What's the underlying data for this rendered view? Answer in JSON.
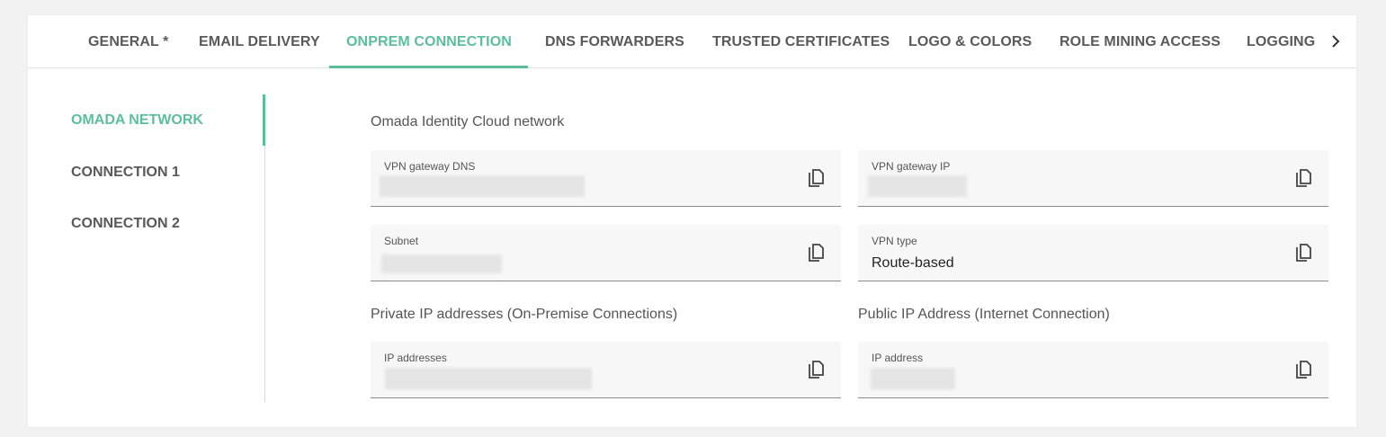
{
  "tabs": [
    {
      "label": "GENERAL *",
      "active": false
    },
    {
      "label": "EMAIL DELIVERY",
      "active": false
    },
    {
      "label": "ONPREM CONNECTION",
      "active": true
    },
    {
      "label": "DNS FORWARDERS",
      "active": false
    },
    {
      "label": "TRUSTED CERTIFICATES",
      "active": false
    },
    {
      "label": "LOGO & COLORS",
      "active": false
    },
    {
      "label": "ROLE MINING ACCESS",
      "active": false
    },
    {
      "label": "LOGGING",
      "active": false
    }
  ],
  "tab_scroll_icon": "chevron-right-icon",
  "sidenav": {
    "items": [
      {
        "label": "OMADA NETWORK",
        "active": true
      },
      {
        "label": "CONNECTION 1",
        "active": false
      },
      {
        "label": "CONNECTION 2",
        "active": false
      }
    ]
  },
  "main": {
    "network_title": "Omada Identity Cloud network",
    "private_title": "Private IP addresses (On-Premise Connections)",
    "public_title": "Public IP Address (Internet Connection)",
    "fields": {
      "vpn_gateway_dns": {
        "label": "VPN gateway DNS",
        "value": ""
      },
      "vpn_gateway_ip": {
        "label": "VPN gateway IP",
        "value": ""
      },
      "subnet": {
        "label": "Subnet",
        "value": ""
      },
      "vpn_type": {
        "label": "VPN type",
        "value": "Route-based"
      },
      "ip_addresses": {
        "label": "IP addresses",
        "value": ""
      },
      "ip_address": {
        "label": "IP address",
        "value": ""
      }
    },
    "copy_icon": "copy-icon"
  },
  "colors": {
    "accent": "#5cbf9c",
    "tab_text": "#5a5a5a",
    "field_bg": "#f7f7f7",
    "page_bg": "#f2f2f2"
  }
}
